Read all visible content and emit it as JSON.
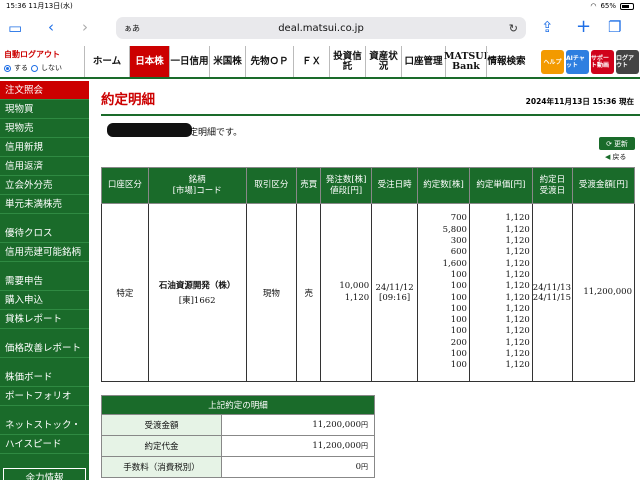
{
  "status": {
    "time": "15:36",
    "date": "11月13日(水)",
    "battery": "65%",
    "battery_level": 0.65
  },
  "safari": {
    "aa": "ぁあ",
    "url": "deal.matsui.co.jp"
  },
  "logout": {
    "title": "自動ログアウト",
    "opt_on": "する",
    "opt_off": "しない"
  },
  "tabs": [
    "ホーム",
    "日本株",
    "一日信用",
    "米国株",
    "先物ＯＰ",
    "ＦＸ",
    "投資信託",
    "資産状況",
    "口座管理",
    "MATSUI Bank",
    "情報検索"
  ],
  "quick": [
    {
      "label": "ヘルプ",
      "color": "#f39a00"
    },
    {
      "label": "AIチャット",
      "color": "#2e7fe0"
    },
    {
      "label": "サポート動画",
      "color": "#d0021b"
    },
    {
      "label": "ログアウト",
      "color": "#444444"
    }
  ],
  "sidebar": [
    "注文照会",
    "現物買",
    "現物売",
    "信用新規",
    "信用返済",
    "立会外分売",
    "単元未満株売",
    "優待クロス",
    "信用売建可能銘柄",
    "需要申告",
    "購入申込",
    "貸株レポート",
    "価格改善レポート",
    "株価ボード",
    "ポートフォリオ",
    "ネットストック・",
    "ハイスピード",
    "余力情報"
  ],
  "page": {
    "title": "約定明細",
    "timestamp": "2024年11月13日 15:36 現在",
    "message": "定明細です。",
    "update": "更新",
    "back": "戻る"
  },
  "table": {
    "headers": [
      "口座区分",
      "銘柄\n[市場]コード",
      "取引区分",
      "売買",
      "発注数[株]\n値段[円]",
      "受注日時",
      "約定数[株]",
      "約定単価[円]",
      "約定日\n受渡日",
      "受渡金額[円]"
    ],
    "row": {
      "account": "特定",
      "name": "石油資源開発（株）",
      "code": "[東]1662",
      "trade_type": "現物",
      "side": "売",
      "order_qty": "10,000",
      "order_price": "1,120",
      "order_date": "24/11/12",
      "order_time": "[09:16]",
      "fills_qty": [
        "700",
        "5,800",
        "300",
        "600",
        "1,600",
        "100",
        "100",
        "100",
        "100",
        "100",
        "100",
        "200",
        "100",
        "100"
      ],
      "fills_price": [
        "1,120",
        "1,120",
        "1,120",
        "1,120",
        "1,120",
        "1,120",
        "1,120",
        "1,120",
        "1,120",
        "1,120",
        "1,120",
        "1,120",
        "1,120",
        "1,120"
      ],
      "exec_date": "24/11/13",
      "settle_date": "24/11/15",
      "amount": "11,200,000"
    }
  },
  "summary": {
    "title": "上記約定の明細",
    "rows": [
      {
        "k": "受渡金額",
        "v": "11,200,000",
        "unit": "円"
      },
      {
        "k": "約定代金",
        "v": "11,200,000",
        "unit": "円"
      },
      {
        "k": "手数料（消費税別）",
        "v": "0",
        "unit": "円"
      }
    ]
  }
}
